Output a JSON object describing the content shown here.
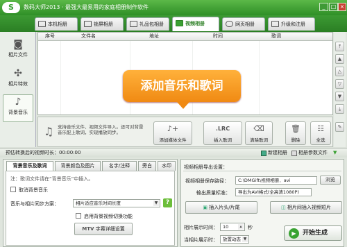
{
  "window": {
    "logo": "S",
    "title": "数码大师2013 · 最强大最易用的家庭相册制作软件",
    "min": "_",
    "max": "□",
    "close": "×"
  },
  "tabs": [
    {
      "label": "本机相册"
    },
    {
      "label": "锁屏相册"
    },
    {
      "label": "礼品包相册"
    },
    {
      "label": "视频相册"
    },
    {
      "label": "网页相册"
    },
    {
      "label": "升级和注册"
    }
  ],
  "sidebar": {
    "items": [
      {
        "label": "相片文件"
      },
      {
        "label": "相片特效"
      },
      {
        "label": "背景音乐"
      }
    ]
  },
  "table": {
    "columns": [
      "序号",
      "文件名",
      "地址",
      "时间",
      "歌词"
    ]
  },
  "callout": "添加音乐和歌词",
  "actions": {
    "tip": "支持音乐文件、视频文件导入。还可对背景音乐配上歌词，实现播放同步。",
    "add_media": "添加媒体文件",
    "lrc_glyph": ".LRC",
    "insert_lyrics": "插入歌词",
    "clear_lyrics": "清除歌词",
    "delete": "删除",
    "select_all": "全选"
  },
  "timebar": {
    "duration_label": "预估转换后的视频时长：00:00:00",
    "new_album": "新建相册",
    "album_params": "相册参数文件"
  },
  "left_panel": {
    "tabs": [
      "背景音乐及歌词",
      "背景颜色及图片",
      "名字/注释",
      "旁白",
      "水印"
    ],
    "note": "注：歌词文件请在“背景音乐”中插入。",
    "cancel_bgm": "取消背景音乐",
    "sync_label": "音乐与相片同步方案：",
    "sync_value": "相片适应音乐时间长度",
    "help": "?",
    "enable_switch": "启用背景视频切换功能",
    "mtv_glyph": "MTV",
    "subtitle_settings": "字幕详细设置"
  },
  "right_panel": {
    "header": "视频相册导出设置：",
    "save_path_label": "视频相册保存路径：",
    "save_path_value": "C:\\DMGift\\视频相册．avi",
    "browse": "浏览",
    "quality_label": "输出质量标准：",
    "quality_value": "导出为AVI格式(全高清1080P)",
    "insert_clip": "插入片头/片尾",
    "insert_video": "相片间插入视频短片",
    "duration_label": "相片展示时间：",
    "duration_value": "10",
    "duration_unit": "秒",
    "effect_label": "当相片展示时：",
    "effect_value": "放置动态",
    "start": "开始生成",
    "play_glyph": "▶"
  },
  "colors": {
    "brand_green": "#3aa033",
    "callout_orange": "#f59a1d"
  }
}
